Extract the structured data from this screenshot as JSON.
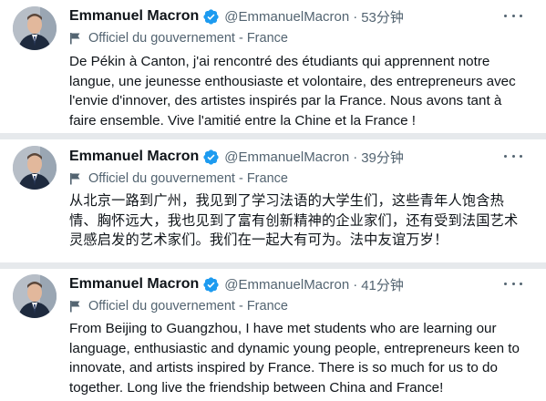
{
  "tweets": [
    {
      "name": "Emmanuel Macron",
      "handle": "@EmmanuelMacron",
      "separator": "·",
      "time": "53分钟",
      "label": "Officiel du gouvernement - France",
      "text": "De Pékin à Canton, j'ai rencontré des étudiants qui apprennent notre langue, une jeunesse enthousiaste et volontaire, des entrepreneurs avec l'envie d'innover, des artistes inspirés par la France. Nous avons tant à faire ensemble. Vive l'amitié entre la Chine et la France !"
    },
    {
      "name": "Emmanuel Macron",
      "handle": "@EmmanuelMacron",
      "separator": "·",
      "time": "39分钟",
      "label": "Officiel du gouvernement - France",
      "text": "从北京一路到广州，我见到了学习法语的大学生们，这些青年人饱含热情、胸怀远大，我也见到了富有创新精神的企业家们，还有受到法国艺术灵感启发的艺术家们。我们在一起大有可为。法中友谊万岁！"
    },
    {
      "name": "Emmanuel Macron",
      "handle": "@EmmanuelMacron",
      "separator": "·",
      "time": "41分钟",
      "label": "Officiel du gouvernement - France",
      "text": "From Beijing to Guangzhou, I have met students who are learning our language, enthusiastic and dynamic young people, entrepreneurs keen to innovate, and artists inspired by France. There is so much for us to do together. Long live the friendship between China and France!"
    }
  ],
  "colors": {
    "verified": "#1d9bf0",
    "secondary_text": "#536471",
    "separator": "#e6e9ec"
  },
  "icons": {
    "verified": "verified-badge-icon",
    "label": "flag-icon",
    "more": "more-dots-icon"
  }
}
